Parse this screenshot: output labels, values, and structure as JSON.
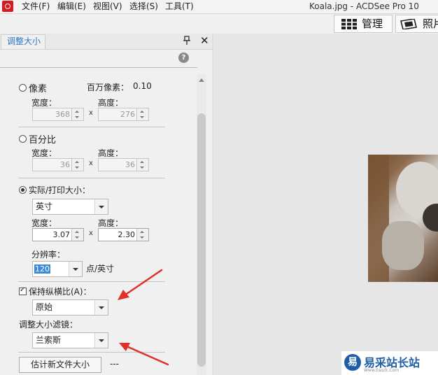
{
  "titlebar": {
    "menus": [
      "文件(F)",
      "编辑(E)",
      "视图(V)",
      "选择(S)",
      "工具(T)"
    ],
    "window_title": "Koala.jpg - ACDSee Pro 10"
  },
  "mode_buttons": {
    "manage": "管理",
    "photo": "照片"
  },
  "panel": {
    "tab": "调整大小",
    "pin_glyph": "📌",
    "close_glyph": "✕",
    "help_glyph": "?",
    "pixels": {
      "label": "像素",
      "megapixels_label": "百万像素：",
      "megapixels_value": "0.10",
      "width_label": "宽度：",
      "width_value": "368",
      "height_label": "高度：",
      "height_value": "276",
      "x": "x"
    },
    "percent": {
      "label": "百分比",
      "width_label": "宽度：",
      "width_value": "36",
      "height_label": "高度：",
      "height_value": "36",
      "x": "x"
    },
    "actual": {
      "label": "实际/打印大小：",
      "unit": "英寸",
      "width_label": "宽度：",
      "width_value": "3.07",
      "height_label": "高度：",
      "height_value": "2.30",
      "x": "x",
      "resolution_label": "分辨率：",
      "resolution_value": "120",
      "resolution_unit": "点/英寸"
    },
    "keep_aspect": {
      "label": "保持纵横比(A)：",
      "value": "原始"
    },
    "filter": {
      "label": "调整大小滤镜：",
      "value": "兰索斯"
    },
    "estimate": {
      "button": "估计新文件大小",
      "value": "---"
    }
  },
  "watermark": {
    "logo": "易",
    "text": "易采站长站",
    "sub": "Www.Easck.Com"
  },
  "colors": {
    "arrow_red": "#e0302a",
    "tab_blue": "#2a78c2",
    "watermark_blue": "#1f5fa8"
  }
}
